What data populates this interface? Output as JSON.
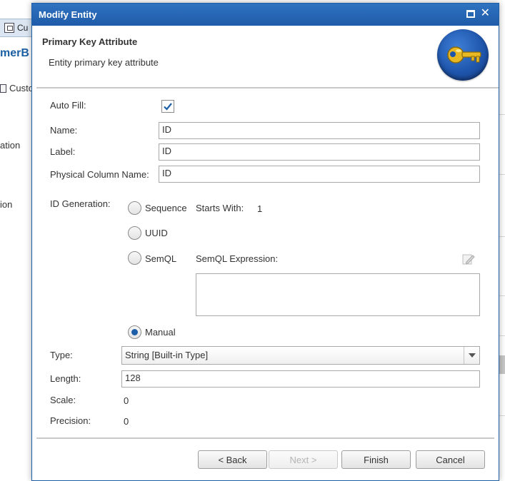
{
  "background": {
    "tab_label": "Cu",
    "title": "merB",
    "item1": "Custo",
    "item2": "ation",
    "item3": "ion"
  },
  "dialog": {
    "title": "Modify Entity",
    "header_title": "Primary Key Attribute",
    "header_subtitle": "Entity primary key attribute",
    "fields": {
      "auto_fill_label": "Auto Fill:",
      "auto_fill_checked": true,
      "name_label": "Name:",
      "name_value": "ID",
      "label_label": "Label:",
      "label_value": "ID",
      "physical_label": "Physical Column Name:",
      "physical_value": "ID"
    },
    "id_generation": {
      "label": "ID Generation:",
      "sequence": "Sequence",
      "starts_with_label": "Starts With:",
      "starts_with_value": "1",
      "uuid": "UUID",
      "semql": "SemQL",
      "semql_expression_label": "SemQL Expression:",
      "semql_expression_value": "",
      "manual": "Manual",
      "selected": "Manual"
    },
    "type_label": "Type:",
    "type_value": "String [Built-in Type]",
    "length_label": "Length:",
    "length_value": "128",
    "scale_label": "Scale:",
    "scale_value": "0",
    "precision_label": "Precision:",
    "precision_value": "0",
    "buttons": {
      "back": "< Back",
      "next": "Next >",
      "finish": "Finish",
      "cancel": "Cancel"
    }
  },
  "colors": {
    "titlebar": "#1f5ba8",
    "accent": "#1c5ea8",
    "key_gold": "#e8b923"
  },
  "icons": {
    "maximize": "maximize-icon",
    "close": "close-icon",
    "key": "key-icon",
    "edit": "edit-pencil-icon",
    "check": "checkmark-icon"
  }
}
